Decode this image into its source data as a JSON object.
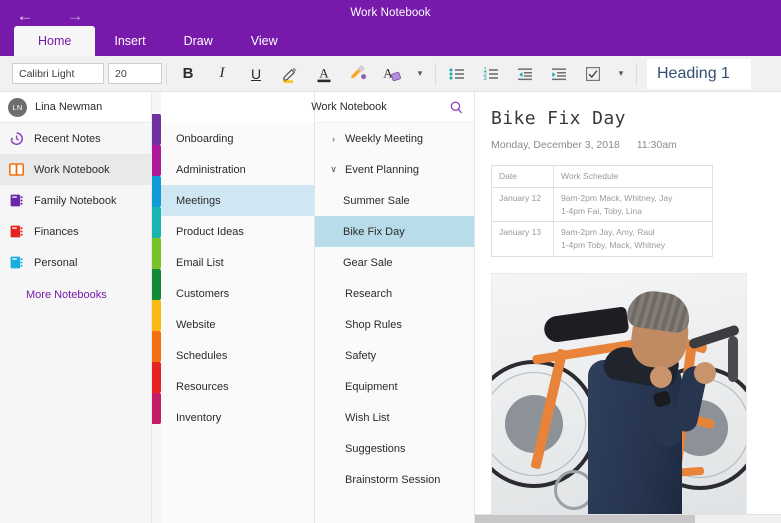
{
  "window": {
    "title": "Work Notebook",
    "back_icon": "back-arrow-icon",
    "forward_icon": "forward-arrow-icon"
  },
  "ribbon": {
    "tabs": [
      {
        "label": "Home",
        "active": true
      },
      {
        "label": "Insert",
        "active": false
      },
      {
        "label": "Draw",
        "active": false
      },
      {
        "label": "View",
        "active": false
      }
    ]
  },
  "format_bar": {
    "font_name": "Calibri Light",
    "font_size": "20",
    "bold_label": "B",
    "italic_label": "I",
    "underline_label": "U",
    "highlight_icon": "highlighter-pen-icon",
    "font_color_icon": "font-color-icon",
    "format_painter_icon": "format-painter-icon",
    "clear_format_icon": "clear-formatting-icon",
    "font_more_icon": "chevron-down-icon",
    "bullet_list_icon": "bullet-list-icon",
    "numbered_list_icon": "numbered-list-icon",
    "decrease_indent_icon": "decrease-indent-icon",
    "increase_indent_icon": "increase-indent-icon",
    "todo_icon": "checkbox-todo-icon",
    "list_more_icon": "chevron-down-icon",
    "style_value": "Heading 1"
  },
  "sidebar": {
    "user": {
      "initials": "LN",
      "name": "Lina Newman"
    },
    "items": [
      {
        "label": "Recent Notes",
        "icon": "recent-clock-icon",
        "selected": false
      },
      {
        "label": "Work Notebook",
        "icon": "open-book-icon",
        "selected": true
      },
      {
        "label": "Family Notebook",
        "icon": "notebook-icon",
        "selected": false
      },
      {
        "label": "Finances",
        "icon": "notebook-icon",
        "selected": false
      },
      {
        "label": "Personal",
        "icon": "notebook-icon",
        "selected": false
      }
    ],
    "more_label": "More Notebooks",
    "section_colors": [
      "#7030a0",
      "#b0189b",
      "#0f9bd7",
      "#18b5b0",
      "#76c327",
      "#138a36",
      "#fbb713",
      "#f2700f",
      "#e52421",
      "#c21d64"
    ]
  },
  "sections": {
    "items": [
      {
        "label": "Onboarding",
        "selected": false
      },
      {
        "label": "Administration",
        "selected": false
      },
      {
        "label": "Meetings",
        "selected": true
      },
      {
        "label": "Product Ideas",
        "selected": false
      },
      {
        "label": "Email List",
        "selected": false
      },
      {
        "label": "Customers",
        "selected": false
      },
      {
        "label": "Website",
        "selected": false
      },
      {
        "label": "Schedules",
        "selected": false
      },
      {
        "label": "Resources",
        "selected": false
      },
      {
        "label": "Inventory",
        "selected": false
      }
    ]
  },
  "pages": {
    "header_title": "Work Notebook",
    "search_icon": "search-icon",
    "items": [
      {
        "label": "Weekly Meeting",
        "level": 0,
        "twisty": "›",
        "selected": false
      },
      {
        "label": "Event Planning",
        "level": 0,
        "twisty": "∨",
        "selected": false
      },
      {
        "label": "Summer Sale",
        "level": 1,
        "twisty": "",
        "selected": false
      },
      {
        "label": "Bike Fix Day",
        "level": 1,
        "twisty": "",
        "selected": true
      },
      {
        "label": "Gear Sale",
        "level": 1,
        "twisty": "",
        "selected": false
      },
      {
        "label": "Research",
        "level": 0,
        "twisty": "",
        "selected": false
      },
      {
        "label": "Shop Rules",
        "level": 0,
        "twisty": "",
        "selected": false
      },
      {
        "label": "Safety",
        "level": 0,
        "twisty": "",
        "selected": false
      },
      {
        "label": "Equipment",
        "level": 0,
        "twisty": "",
        "selected": false
      },
      {
        "label": "Wish List",
        "level": 0,
        "twisty": "",
        "selected": false
      },
      {
        "label": "Suggestions",
        "level": 0,
        "twisty": "",
        "selected": false
      },
      {
        "label": "Brainstorm Session",
        "level": 0,
        "twisty": "",
        "selected": false
      }
    ]
  },
  "canvas": {
    "title": "Bike Fix Day",
    "date": "Monday, December 3, 2018",
    "time": "11:30am",
    "table": {
      "headers": [
        "Date",
        "Work Schedule"
      ],
      "rows": [
        {
          "date": "January 12",
          "line1": "9am-2pm Mack, Whitney, Jay",
          "line2": "1-4pm Fai, Toby, Lina"
        },
        {
          "date": "January 13",
          "line1": "9am-2pm Jay, Amy, Raul",
          "line2": "1-4pm Toby, Mack, Whitney"
        }
      ]
    },
    "photo_alt": "Man carrying orange bicycle on shoulder"
  },
  "colors": {
    "brand_purple": "#7719aa",
    "section_selected": "#cfe7f2",
    "page_selected": "#b8dcea",
    "accent_orange": "#e8833a"
  }
}
